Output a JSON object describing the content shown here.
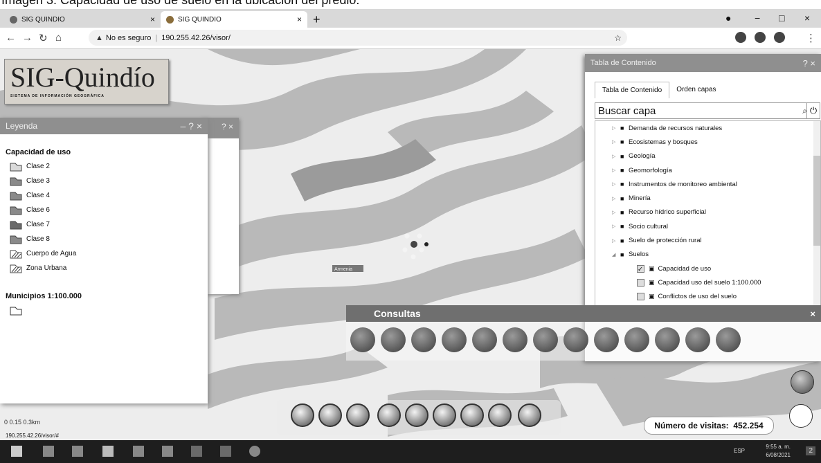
{
  "caption": "Imagen 3: Capacidad de uso de suelo en la ubicación del predio.",
  "browser": {
    "tabs": [
      {
        "label": "SIG QUINDIO"
      },
      {
        "label": "SIG QUINDIO"
      }
    ],
    "new_tab": "+",
    "controls": {
      "minimize": "−",
      "maximize": "□",
      "close": "×"
    },
    "security": "No es seguro",
    "url": "190.255.42.26/visor/"
  },
  "logo": {
    "title": "SIG-Quindío",
    "subtitle": "SISTEMA DE INFORMACIÓN GEOGRÁFICA"
  },
  "legend": {
    "title": "Leyenda",
    "controls": "– ? ×",
    "back_controls": "? ×",
    "groups": [
      {
        "title": "Capacidad de uso",
        "items": [
          {
            "label": "Clase 2",
            "color": "#d9d9d9"
          },
          {
            "label": "Clase 3",
            "color": "#8a8a8a"
          },
          {
            "label": "Clase 4",
            "color": "#8a8a8a"
          },
          {
            "label": "Clase 6",
            "color": "#8a8a8a"
          },
          {
            "label": "Clase 7",
            "color": "#6a6a6a"
          },
          {
            "label": "Clase 8",
            "color": "#8a8a8a"
          },
          {
            "label": "Cuerpo de Agua",
            "color": "#ffffff"
          },
          {
            "label": "Zona Urbana",
            "color": "#ffffff"
          }
        ]
      },
      {
        "title": "Municipios 1:100.000",
        "items": []
      }
    ]
  },
  "toc": {
    "title": "Tabla de Contenido",
    "controls": "? ×",
    "tabs": [
      "Tabla de Contenido",
      "Orden capas"
    ],
    "search_placeholder": "Buscar capa",
    "folders": [
      "Demanda de recursos naturales",
      "Ecosistemas y bosques",
      "Geología",
      "Geomorfología",
      "Instrumentos de monitoreo ambiental",
      "Minería",
      "Recurso hídrico superficial",
      "Socio cultural",
      "Suelo de protección rural",
      "Suelos"
    ],
    "layers": [
      {
        "label": "Capacidad de uso",
        "checked": true
      },
      {
        "label": "Capacidad uso del suelo 1:100.000",
        "checked": false
      },
      {
        "label": "Conflictos de uso del suelo",
        "checked": false
      }
    ]
  },
  "consultas": {
    "title": "Consultas",
    "close": "×",
    "tool_count": 13
  },
  "map": {
    "marker_label": "Armenia"
  },
  "footer": {
    "visits_label": "Número de visitas:",
    "visits_value": "452.254",
    "scale_labels": "0    0.15    0.3km",
    "status_url": "190.255.42.26/visor/#"
  },
  "taskbar": {
    "lang": "ESP",
    "time": "9:55 a. m.",
    "date": "6/08/2021",
    "notifications": "2"
  }
}
